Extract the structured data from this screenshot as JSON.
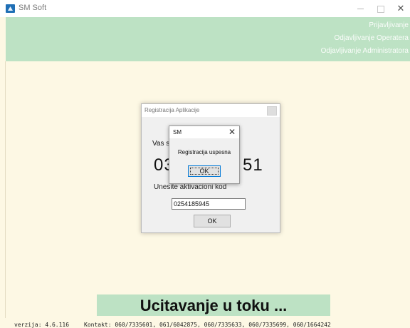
{
  "window": {
    "title": "SM Soft",
    "icon": "app-logo-icon",
    "controls": {
      "minimize": "—",
      "maximize": "",
      "close": "✕"
    }
  },
  "header": {
    "menu": [
      {
        "label": "Prijavljivanje"
      },
      {
        "label": "Odjavljivanje Operatera"
      },
      {
        "label": "Odjavljivanje Administratora"
      }
    ]
  },
  "registration_dialog": {
    "title": "Registracija Aplikacije",
    "serial_label": "Vas ser",
    "serial_value_left": "03",
    "serial_value_right": "51",
    "activation_label": "Unesite aktivacioni kod",
    "activation_code": "0254185945",
    "ok_label": "OK"
  },
  "message_box": {
    "title": "SM",
    "close": "✕",
    "text": "Registracija uspesna",
    "ok_label": "OK"
  },
  "loading": {
    "text": "Ucitavanje u toku ..."
  },
  "status": {
    "version": "verzija: 4.6.116",
    "contact": "Kontakt: 060/7335601, 061/6042875, 060/7335633, 060/7335699, 060/1664242"
  },
  "colors": {
    "background": "#fdf8e4",
    "header_green": "#bde2c4",
    "dialog_gray": "#f0f0f0",
    "focus_blue": "#0078d7"
  }
}
